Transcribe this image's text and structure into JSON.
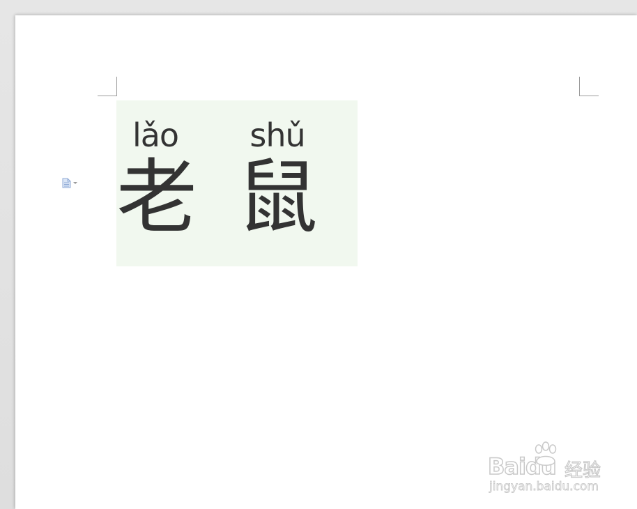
{
  "document": {
    "paragraph_marker_icon": "document-icon",
    "phonetic_text": [
      {
        "pinyin": "lǎo",
        "hanzi": "老"
      },
      {
        "pinyin": "shǔ",
        "hanzi": "鼠"
      }
    ],
    "colors": {
      "page": "#ffffff",
      "workspace": "#e3e3e3",
      "highlight": "#f1f8ef",
      "text": "#333333"
    }
  },
  "watermark": {
    "brand": "Baidu",
    "brand_suffix": "经验",
    "url": "jingyan.baidu.com"
  }
}
